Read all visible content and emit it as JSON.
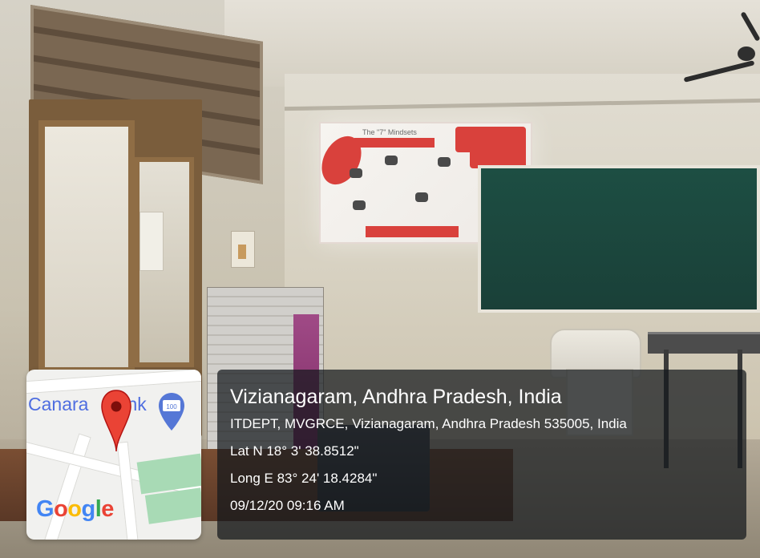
{
  "map": {
    "poi_label": "Canara",
    "poi_label_tail": "nk",
    "poi_badge": "100",
    "logo": {
      "letters": [
        "G",
        "o",
        "o",
        "g",
        "l",
        "e"
      ],
      "colors": [
        "#4285F4",
        "#EA4335",
        "#FBBC05",
        "#4285F4",
        "#34A853",
        "#EA4335"
      ]
    },
    "pin_color": "#EA4335",
    "poi_color": "#5577D6",
    "park_color": "#A8DAB5"
  },
  "overlay": {
    "city": "Vizianagaram, Andhra Pradesh, India",
    "address": "ITDEPT, MVGRCE, Vizianagaram, Andhra Pradesh 535005, India",
    "latitude": "Lat N 18° 3' 38.8512\"",
    "longitude": "Long E 83° 24' 18.4284\"",
    "timestamp": "09/12/20 09:16 AM"
  },
  "scene": {
    "slide_title": "The \"7\" Mindsets",
    "accent_color": "#D9413C",
    "board_color": "#1D4E43"
  }
}
